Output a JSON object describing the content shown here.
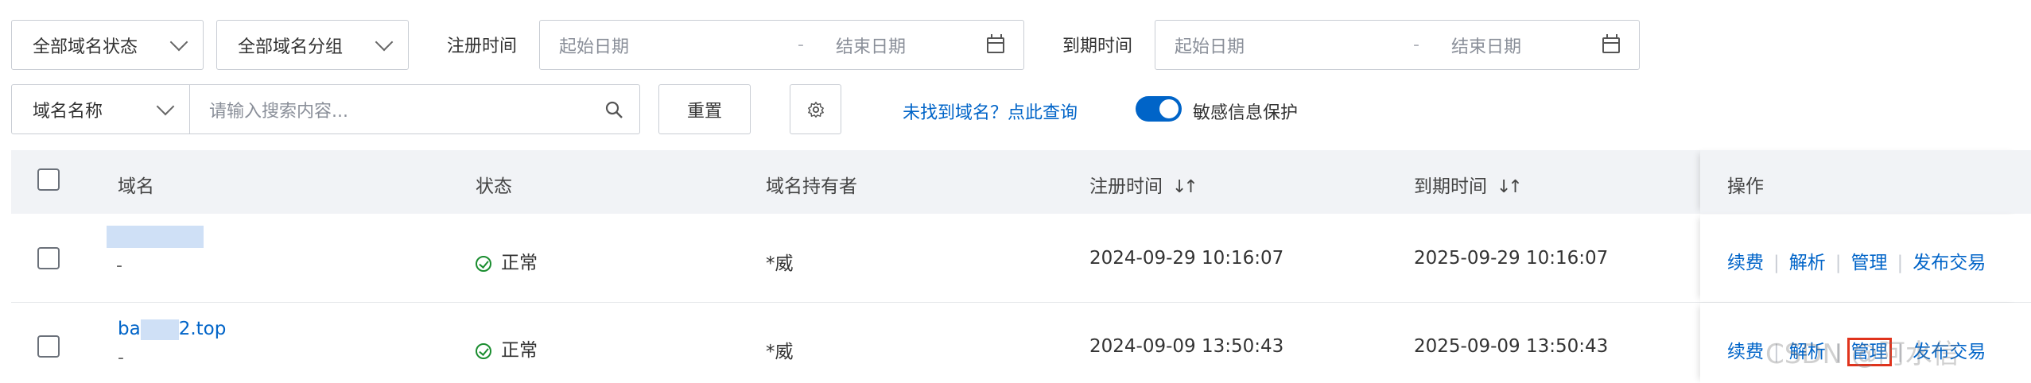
{
  "filters": {
    "status_select": "全部域名状态",
    "group_select": "全部域名分组",
    "reg_time_label": "注册时间",
    "reg_start_placeholder": "起始日期",
    "reg_end_placeholder": "结束日期",
    "exp_time_label": "到期时间",
    "exp_start_placeholder": "起始日期",
    "exp_end_placeholder": "结束日期",
    "date_separator": "-",
    "field_select": "域名名称",
    "search_placeholder": "请输入搜索内容...",
    "reset_button": "重置",
    "not_found_link": "未找到域名？点此查询",
    "privacy_toggle_label": "敏感信息保护",
    "privacy_toggle_on": true
  },
  "table": {
    "columns": [
      "域名",
      "状态",
      "域名持有者",
      "注册时间",
      "到期时间",
      "操作"
    ],
    "sortable_columns": [
      "注册时间",
      "到期时间"
    ],
    "rows": [
      {
        "domain_name": "",
        "domain_sub": "-",
        "status": "正常",
        "holder": "*威",
        "reg_time": "2024-09-29 10:16:07",
        "exp_time": "2025-09-29 10:16:07",
        "actions": [
          "续费",
          "解析",
          "管理",
          "发布交易"
        ]
      },
      {
        "domain_prefix": "ba",
        "domain_suffix": "2.top",
        "domain_sub": "-",
        "status": "正常",
        "holder": "*威",
        "reg_time": "2024-09-09 13:50:43",
        "exp_time": "2025-09-09 13:50:43",
        "actions": [
          "续费",
          "解析",
          "管理",
          "发布交易"
        ]
      }
    ]
  },
  "watermark": "CSDN @阿水信",
  "colors": {
    "link": "#0064c8",
    "status_ok": "#1a8d2f",
    "highlight": "#e0331c",
    "header_bg": "#f1f3f6"
  }
}
